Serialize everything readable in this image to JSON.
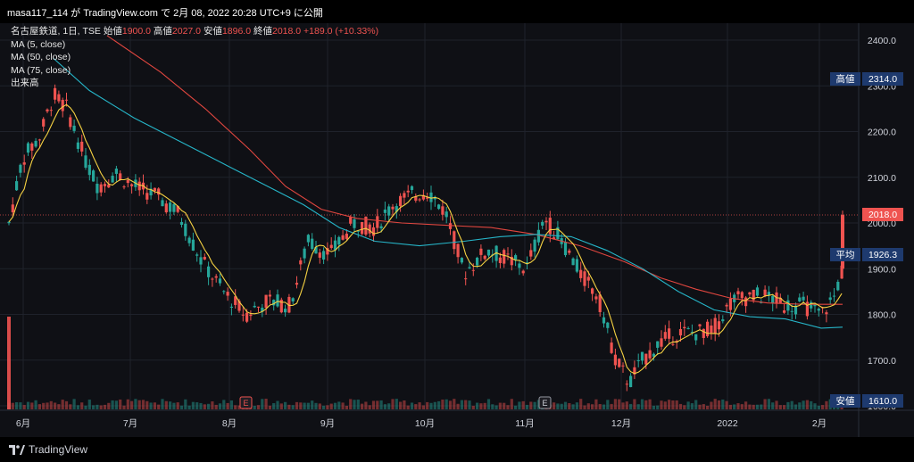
{
  "header": {
    "publish_line": "masa117_114 が TradingView.com で 2月 08, 2022 20:28 UTC+9 に公開"
  },
  "legend": {
    "symbol": "名古屋鉄道, 1日, TSE",
    "open_label": "始値",
    "open_value": "1900.0",
    "high_label": "高値",
    "high_value": "2027.0",
    "low_label": "安値",
    "low_value": "1896.0",
    "close_label": "終値",
    "close_value": "2018.0",
    "change": "+189.0 (+10.33%)",
    "ma5": "MA (5, close)",
    "ma50": "MA (50, close)",
    "ma75": "MA (75, close)",
    "volume": "出来高"
  },
  "axis": {
    "y_ticks": [
      "2400.0",
      "2300.0",
      "2200.0",
      "2100.0",
      "2000.0",
      "1900.0",
      "1800.0",
      "1700.0",
      "1600.0"
    ],
    "x_ticks": [
      "6月",
      "7月",
      "8月",
      "9月",
      "10月",
      "11月",
      "12月",
      "2022",
      "2月"
    ],
    "earnings_marker": "E"
  },
  "price_tags": {
    "high_label": "高値",
    "high_value": "2314.0",
    "last_value": "2018.0",
    "avg_label": "平均",
    "avg_value": "1926.3",
    "low_label": "安値",
    "low_value": "1610.0"
  },
  "colors": {
    "up": "#26a69a",
    "down": "#ef5350",
    "ma5": "#f5d142",
    "ma50": "#26b5c8",
    "ma75": "#e0463f",
    "tag_bg": "#1e3a6e"
  },
  "footer": {
    "brand": "TradingView"
  }
}
